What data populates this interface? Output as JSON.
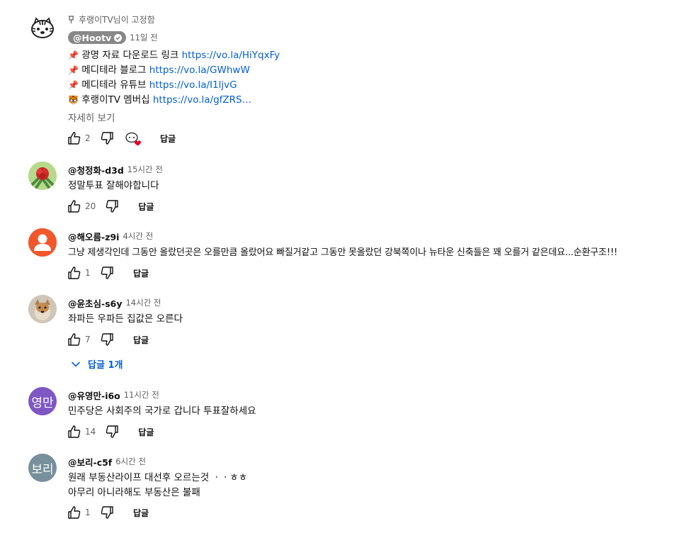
{
  "pinned": {
    "label": "후랭이TV님이 고정함",
    "author": "@Hootv",
    "time": "11일 전",
    "lines": [
      {
        "emoji": "📌",
        "text": "광명 자료 다운로드 링크 ",
        "link": "https://vo.la/HiYqxFy"
      },
      {
        "emoji": "📌",
        "text": "메디테라 블로그 ",
        "link": "https://vo.la/GWhwW"
      },
      {
        "emoji": "📌",
        "text": "메디테라 유튜브 ",
        "link": "https://vo.la/I1ljvG"
      },
      {
        "emoji": "🐯",
        "text": "후랭이TV 멤버십 ",
        "link": "https://vo.la/gfZRS…"
      }
    ],
    "more_label": "자세히 보기",
    "likes": "2",
    "reply_label": "답글"
  },
  "comments": [
    {
      "author": "@청정화-d3d",
      "time": "15시간 전",
      "lines": [
        "정말투표 잘해야합니다"
      ],
      "likes": "20",
      "reply_label": "답글",
      "avatar_icon": "flower-avatar"
    },
    {
      "author": "@해오름-z9i",
      "time": "4시간 전",
      "lines": [
        "그냥 제생각인데 그동안 올랐던곳은 오를만큼 올랐어요 빠질거같고 그동안 못올랐던 강북쪽이나 뉴타운 신축들은 꽤 오를거 같은데요...순환구조!!!"
      ],
      "likes": "1",
      "reply_label": "답글",
      "avatar_icon": "default-user-avatar"
    },
    {
      "author": "@윤초심-s6y",
      "time": "14시간 전",
      "lines": [
        "좌파든 우파든 집값은 오른다"
      ],
      "likes": "7",
      "reply_label": "답글",
      "avatar_icon": "dog-avatar",
      "replies_label": "답글 1개"
    },
    {
      "author": "@유영만-i6o",
      "time": "11시간 전",
      "lines": [
        "민주당은 사회주의 국가로 갑니다 투표잘하세요"
      ],
      "likes": "14",
      "reply_label": "답글",
      "avatar_letters": "영만",
      "avatar_color": "#7e57c2"
    },
    {
      "author": "@보리-c5f",
      "time": "6시간 전",
      "lines": [
        "원래 부동산라이프 대선후 오르는것 ㆍㆍㅎㅎ",
        "아무리 아니라해도 부동산은 불패"
      ],
      "likes": "1",
      "reply_label": "답글",
      "avatar_letters": "보리",
      "avatar_color": "#78909c"
    }
  ],
  "colors": {
    "link": "#065fd4",
    "secondary_text": "#606060",
    "primary_text": "#0f0f0f"
  }
}
